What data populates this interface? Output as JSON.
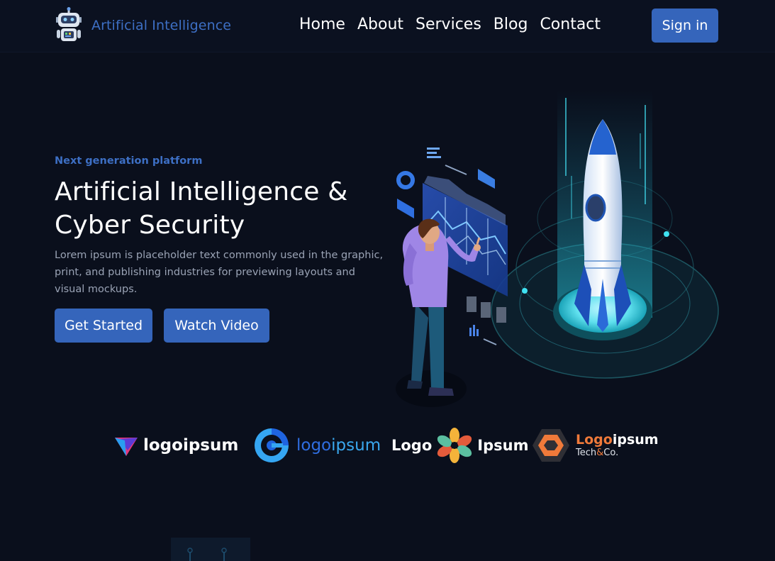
{
  "brand": {
    "name": "Artificial Intelligence",
    "logo_icon": "robot-icon"
  },
  "nav": {
    "links": [
      "Home",
      "About",
      "Services",
      "Blog",
      "Contact"
    ],
    "signin_label": "Sign in"
  },
  "hero": {
    "eyebrow": "Next generation platform",
    "title_line1": "Artificial Intelligence &",
    "title_line2": "Cyber Security",
    "description": "Lorem ipsum is placeholder text commonly used in the graphic, print, and publishing industries for previewing layouts and visual mockups.",
    "get_started_label": "Get Started",
    "watch_video_label": "Watch Video",
    "illustration": "person-with-dashboard-and-rocket-illustration"
  },
  "partner_logos": {
    "logo1": "logoipsum",
    "logo2_a": "logo",
    "logo2_b": "ipsum",
    "logo3_a": "Logo",
    "logo3_b": "Ipsum",
    "logo4_a": "Logo",
    "logo4_b": "ipsum",
    "logo4_sub_a": "Tech",
    "logo4_sub_amp": "&",
    "logo4_sub_b": "Co."
  },
  "colors": {
    "background": "#0a0f1c",
    "accent": "#3565bb",
    "brand_text": "#3d6fc4",
    "muted_text": "#9aa3b5"
  }
}
